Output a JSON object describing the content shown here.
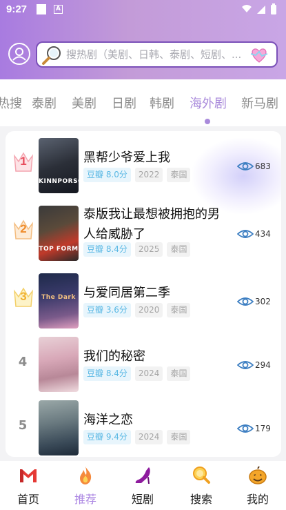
{
  "status_bar": {
    "time": "9:27",
    "notification_letter": "A"
  },
  "search": {
    "placeholder": "搜热剧（美剧、日韩、泰剧、短剧、..."
  },
  "tabs": [
    {
      "label": "热搜"
    },
    {
      "label": "泰剧"
    },
    {
      "label": "美剧"
    },
    {
      "label": "日剧"
    },
    {
      "label": "韩剧"
    },
    {
      "label": "海外剧",
      "active": true
    },
    {
      "label": "新马剧"
    }
  ],
  "ranking": [
    {
      "rank": "1",
      "title": "黑帮少爷爱上我",
      "score": "豆瓣 8.0分",
      "year": "2022",
      "region": "泰国",
      "views": "683",
      "poster_text": "KINNPORSCHE"
    },
    {
      "rank": "2",
      "title": "泰版我让最想被拥抱的男人给威胁了",
      "score": "豆瓣 8.4分",
      "year": "2025",
      "region": "泰国",
      "views": "434",
      "poster_text": "TOP FORM"
    },
    {
      "rank": "3",
      "title": "与爱同居第二季",
      "score": "豆瓣 3.6分",
      "year": "2020",
      "region": "泰国",
      "views": "302",
      "poster_text": "The Dark"
    },
    {
      "rank": "4",
      "title": "我们的秘密",
      "score": "豆瓣 8.4分",
      "year": "2024",
      "region": "泰国",
      "views": "294",
      "poster_text": ""
    },
    {
      "rank": "5",
      "title": "海洋之恋",
      "score": "豆瓣 9.4分",
      "year": "2024",
      "region": "泰国",
      "views": "179",
      "poster_text": ""
    }
  ],
  "colors": {
    "accent": "#a98adb",
    "gold": "#f0b030",
    "brand_red": "#e53935"
  },
  "bottom_nav": [
    {
      "label": "首页",
      "icon": "gmail-logo-icon"
    },
    {
      "label": "推荐",
      "icon": "flame-icon",
      "active": true
    },
    {
      "label": "短剧",
      "icon": "high-heel-icon"
    },
    {
      "label": "搜索",
      "icon": "magnifier-icon"
    },
    {
      "label": "我的",
      "icon": "pumpkin-icon"
    }
  ]
}
